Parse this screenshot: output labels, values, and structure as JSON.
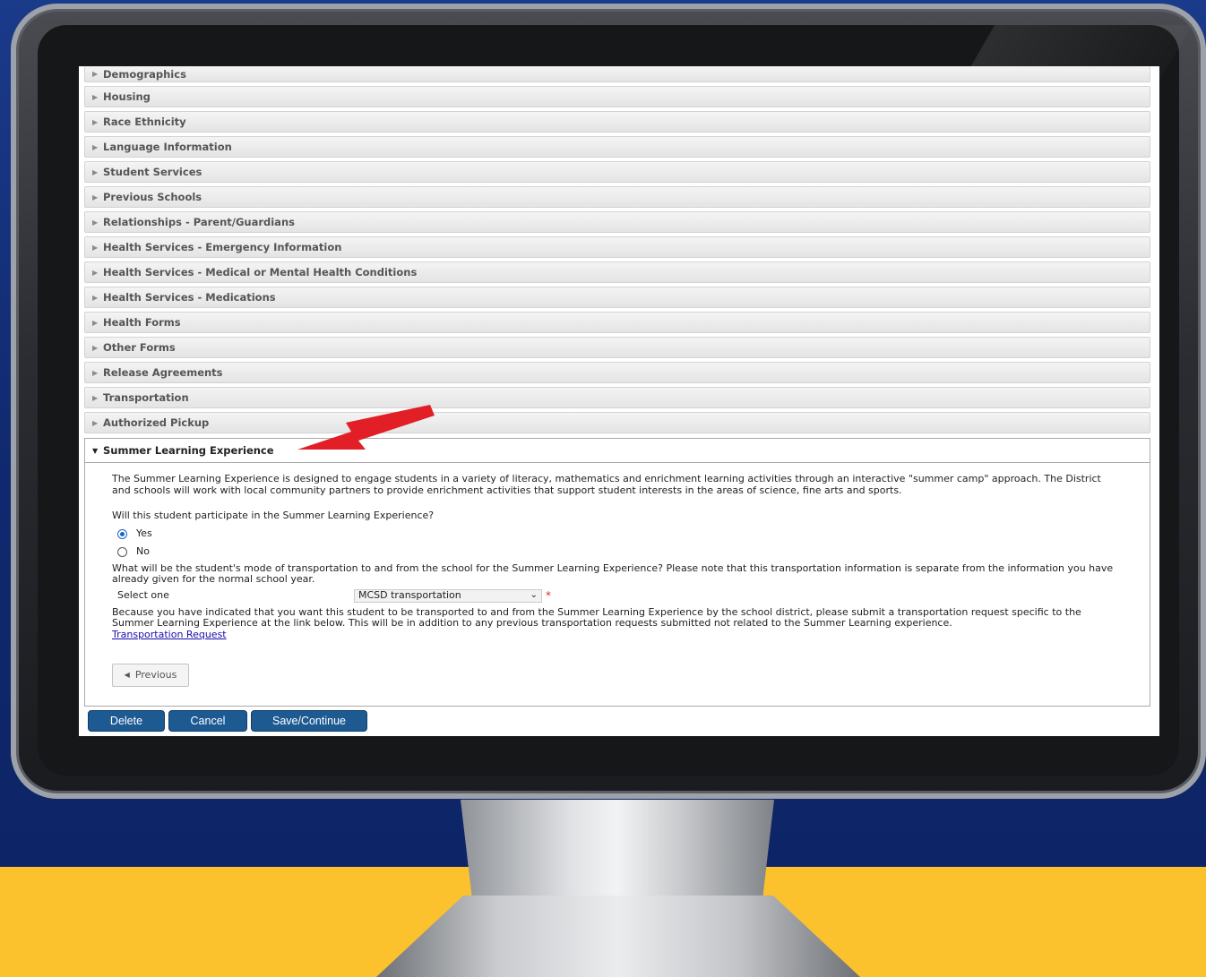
{
  "colors": {
    "background_blue": "#1a3a8a",
    "background_yellow": "#fcc22e",
    "button_blue": "#1d5a92",
    "arrow_red": "#e21f26",
    "required_red": "#e0262b",
    "link_blue": "#1a0dab"
  },
  "accordion": {
    "collapsed_sections": [
      "Demographics",
      "Housing",
      "Race Ethnicity",
      "Language Information",
      "Student Services",
      "Previous Schools",
      "Relationships - Parent/Guardians",
      "Health Services - Emergency Information",
      "Health Services - Medical or Mental Health Conditions",
      "Health Services - Medications",
      "Health Forms",
      "Other Forms",
      "Release Agreements",
      "Transportation",
      "Authorized Pickup"
    ],
    "expanded_section": "Summer Learning Experience"
  },
  "summer": {
    "intro": "The Summer Learning Experience is designed to engage students in a variety of literacy, mathematics and enrichment learning activities through an interactive \"summer camp\" approach. The District and schools will work with local community partners to provide enrichment activities that support student interests in the areas of science, fine arts and sports.",
    "question": "Will this student participate in the Summer Learning Experience?",
    "options": [
      "Yes",
      "No"
    ],
    "selected_option": "Yes",
    "transport_question": "What will be the student's mode of transportation to and from the school for the Summer Learning Experience? Please note that this transportation information is separate from the information you have already given for the normal school year.",
    "select_label": "Select one",
    "select_value": "MCSD transportation",
    "note": "Because you have indicated that you want this student to be transported to and from the Summer Learning Experience by the school district, please submit a transportation request specific to the Summer Learning Experience at the link below. This will be in addition to any previous transportation requests submitted not related to the Summer Learning experience.",
    "link_text": "Transportation Request",
    "previous_label": "Previous"
  },
  "buttons": {
    "delete": "Delete",
    "cancel": "Cancel",
    "save": "Save/Continue"
  }
}
